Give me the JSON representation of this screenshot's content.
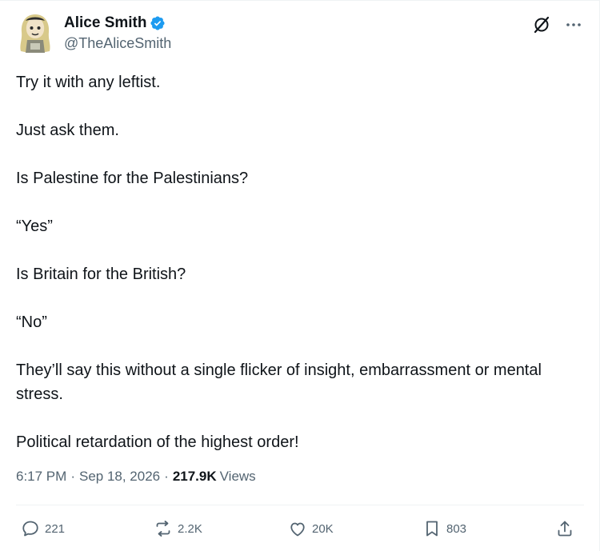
{
  "author": {
    "display_name": "Alice Smith",
    "handle": "@TheAliceSmith",
    "verified": true,
    "verified_color": "#1d9bf0"
  },
  "tweet": {
    "paragraphs": [
      "Try it with any leftist.",
      "Just ask them.",
      "Is Palestine for the Palestinians?",
      "“Yes”",
      "Is Britain for the British?",
      "“No”",
      "They’ll say this without a single flicker of insight, embarrassment or mental stress.",
      "Political retardation of the highest order!"
    ]
  },
  "meta": {
    "time": "6:17 PM",
    "separator": "·",
    "date": "Sep 18, 2026",
    "views_count": "217.9K",
    "views_label": "Views"
  },
  "actions": {
    "replies": "221",
    "reposts": "2.2K",
    "likes": "20K",
    "bookmarks": "803"
  },
  "icons": {
    "grok": "grok-icon",
    "more": "more-icon",
    "reply": "reply-icon",
    "repost": "repost-icon",
    "like": "like-icon",
    "bookmark": "bookmark-icon",
    "share": "share-icon"
  }
}
